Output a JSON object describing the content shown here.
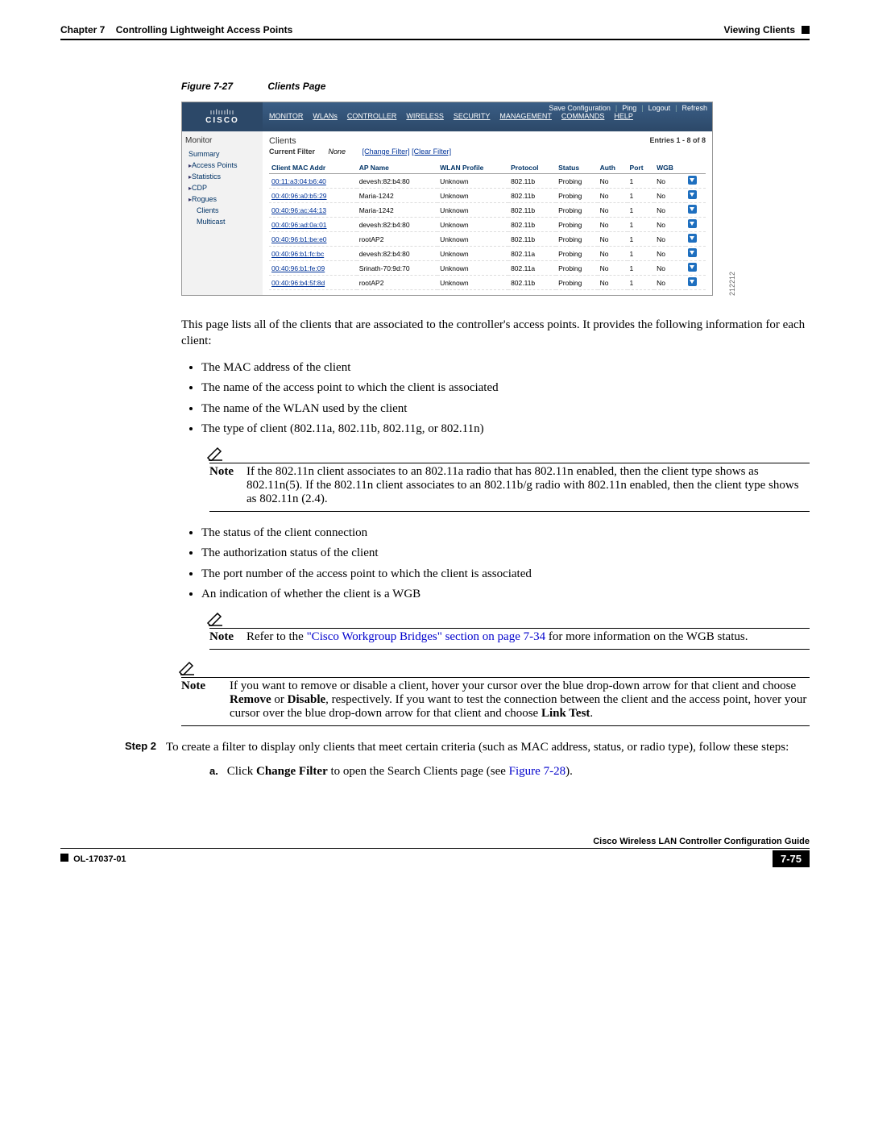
{
  "header": {
    "chapter": "Chapter 7",
    "chapter_title": "Controlling Lightweight Access Points",
    "section": "Viewing Clients"
  },
  "figure": {
    "label": "Figure 7-27",
    "title": "Clients Page",
    "image_id": "212212"
  },
  "controller": {
    "brand_bars": "ıılııılıı",
    "brand": "CISCO",
    "utility": {
      "save": "Save Configuration",
      "ping": "Ping",
      "logout": "Logout",
      "refresh": "Refresh"
    },
    "nav": [
      "MONITOR",
      "WLANs",
      "CONTROLLER",
      "WIRELESS",
      "SECURITY",
      "MANAGEMENT",
      "COMMANDS",
      "HELP"
    ],
    "sidebar": {
      "title": "Monitor",
      "items": [
        {
          "label": "Summary",
          "sub": false,
          "arrow": false
        },
        {
          "label": "Access Points",
          "sub": false,
          "arrow": true
        },
        {
          "label": "Statistics",
          "sub": false,
          "arrow": true
        },
        {
          "label": "CDP",
          "sub": false,
          "arrow": true
        },
        {
          "label": "Rogues",
          "sub": false,
          "arrow": true
        },
        {
          "label": "Clients",
          "sub": true,
          "arrow": false
        },
        {
          "label": "Multicast",
          "sub": true,
          "arrow": false
        }
      ]
    },
    "main": {
      "title": "Clients",
      "entries": "Entries 1 - 8 of 8",
      "filter_label": "Current Filter",
      "filter_value": "None",
      "change_filter": "[Change Filter]",
      "clear_filter": "[Clear Filter]",
      "headers": [
        "Client MAC Addr",
        "AP Name",
        "WLAN Profile",
        "Protocol",
        "Status",
        "Auth",
        "Port",
        "WGB"
      ],
      "rows": [
        {
          "mac": "00:11:a3:04:b6:40",
          "ap": "devesh:82:b4:80",
          "wlan": "Unknown",
          "proto": "802.11b",
          "status": "Probing",
          "auth": "No",
          "port": "1",
          "wgb": "No"
        },
        {
          "mac": "00:40:96:a0:b5:29",
          "ap": "Maria-1242",
          "wlan": "Unknown",
          "proto": "802.11b",
          "status": "Probing",
          "auth": "No",
          "port": "1",
          "wgb": "No"
        },
        {
          "mac": "00:40:96:ac:44:13",
          "ap": "Maria-1242",
          "wlan": "Unknown",
          "proto": "802.11b",
          "status": "Probing",
          "auth": "No",
          "port": "1",
          "wgb": "No"
        },
        {
          "mac": "00:40:96:ad:0a:01",
          "ap": "devesh:82:b4:80",
          "wlan": "Unknown",
          "proto": "802.11b",
          "status": "Probing",
          "auth": "No",
          "port": "1",
          "wgb": "No"
        },
        {
          "mac": "00:40:96:b1:be:e0",
          "ap": "rootAP2",
          "wlan": "Unknown",
          "proto": "802.11b",
          "status": "Probing",
          "auth": "No",
          "port": "1",
          "wgb": "No"
        },
        {
          "mac": "00:40:96:b1:fc:bc",
          "ap": "devesh:82:b4:80",
          "wlan": "Unknown",
          "proto": "802.11a",
          "status": "Probing",
          "auth": "No",
          "port": "1",
          "wgb": "No"
        },
        {
          "mac": "00:40:96:b1:fe:09",
          "ap": "Srinath-70:9d:70",
          "wlan": "Unknown",
          "proto": "802.11a",
          "status": "Probing",
          "auth": "No",
          "port": "1",
          "wgb": "No"
        },
        {
          "mac": "00:40:96:b4:5f:8d",
          "ap": "rootAP2",
          "wlan": "Unknown",
          "proto": "802.11b",
          "status": "Probing",
          "auth": "No",
          "port": "1",
          "wgb": "No"
        }
      ]
    }
  },
  "text": {
    "intro": "This page lists all of the clients that are associated to the controller's access points. It provides the following information for each client:",
    "bullets1": [
      "The MAC address of the client",
      "The name of the access point to which the client is associated",
      "The name of the WLAN used by the client",
      "The type of client (802.11a, 802.11b, 802.11g, or 802.11n)"
    ],
    "note1": "If the 802.11n client associates to an 802.11a radio that has 802.11n enabled, then the client type shows as 802.11n(5). If the 802.11n client associates to an 802.11b/g radio with 802.11n enabled, then the client type shows as 802.11n (2.4).",
    "bullets2": [
      "The status of the client connection",
      "The authorization status of the client",
      "The port number of the access point to which the client is associated",
      "An indication of whether the client is a WGB"
    ],
    "note2_pre": "Refer to the ",
    "note2_link": "\"Cisco Workgroup Bridges\" section on page 7-34",
    "note2_post": " for more information on the WGB status.",
    "note3": "If you want to remove or disable a client, hover your cursor over the blue drop-down arrow for that client and choose Remove or Disable, respectively. If you want to test the connection between the client and the access point, hover your cursor over the blue drop-down arrow for that client and choose Link Test.",
    "note3_html_pre": "If you want to remove or disable a client, hover your cursor over the blue drop-down arrow for that client and choose ",
    "note3_b1": "Remove",
    "note3_mid1": " or ",
    "note3_b2": "Disable",
    "note3_mid2": ", respectively. If you want to test the connection between the client and the access point, hover your cursor over the blue drop-down arrow for that client and choose ",
    "note3_b3": "Link Test",
    "note3_end": ".",
    "note_label": "Note",
    "step2_label": "Step 2",
    "step2_text": "To create a filter to display only clients that meet certain criteria (such as MAC address, status, or radio type), follow these steps:",
    "sub_a_label": "a.",
    "sub_a_pre": "Click ",
    "sub_a_bold": "Change Filter",
    "sub_a_mid": " to open the Search Clients page (see ",
    "sub_a_link": "Figure 7-28",
    "sub_a_post": ")."
  },
  "footer": {
    "guide": "Cisco Wireless LAN Controller Configuration Guide",
    "doc_id": "OL-17037-01",
    "page": "7-75"
  }
}
